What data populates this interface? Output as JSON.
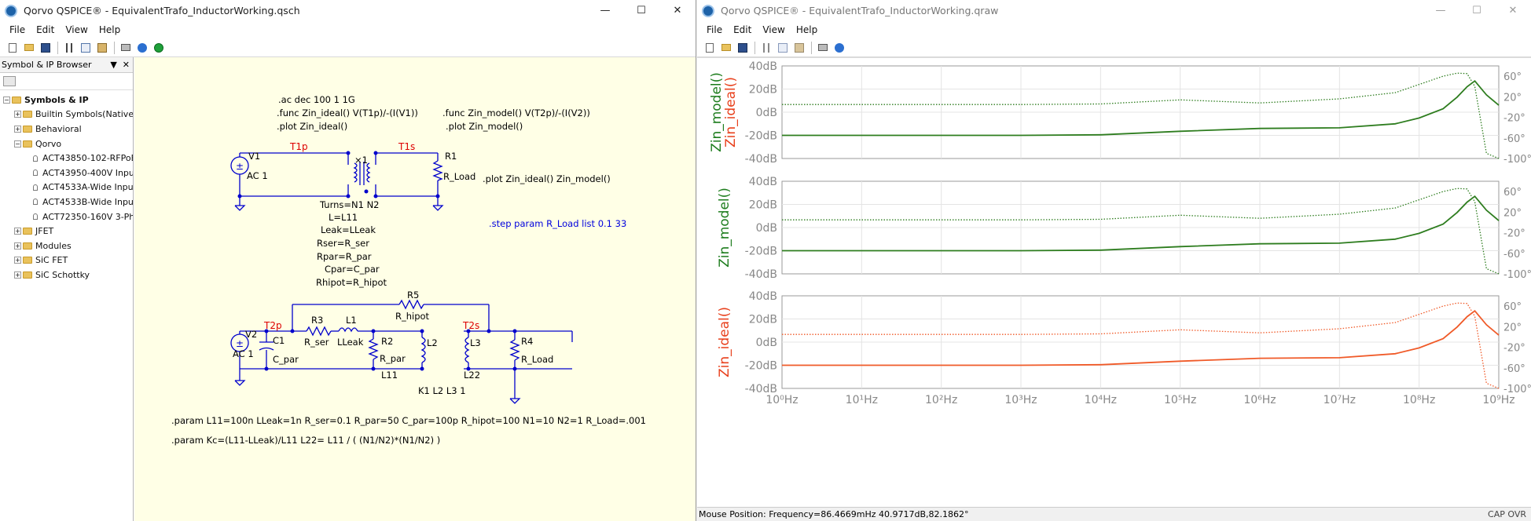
{
  "left_window": {
    "title": "Qorvo QSPICE® - EquivalentTrafo_InductorWorking.qsch",
    "menu": [
      "File",
      "Edit",
      "View",
      "Help"
    ],
    "toolbar_icons": [
      "new-file-icon",
      "open-folder-icon",
      "save-icon",
      "cut-icon",
      "copy-icon",
      "paste-icon",
      "print-icon",
      "help-icon",
      "run-icon"
    ]
  },
  "right_window": {
    "title": "Qorvo QSPICE® - EquivalentTrafo_InductorWorking.qraw",
    "menu": [
      "File",
      "Edit",
      "View",
      "Help"
    ],
    "toolbar_icons": [
      "new-file-icon",
      "open-folder-icon",
      "save-icon",
      "cut-icon",
      "copy-icon",
      "paste-icon",
      "print-icon",
      "help-icon"
    ],
    "status_text": "Mouse Position: Frequency=86.4669mHz   40.9717dB,82.1862°",
    "status_right": "CAP OVR"
  },
  "browser": {
    "title": "Symbol & IP Browser",
    "tree": [
      {
        "label": "Symbols & IP",
        "level": 0,
        "type": "folder",
        "expanded": true,
        "bold": true
      },
      {
        "label": "Builtin Symbols(Native D",
        "level": 1,
        "type": "folder",
        "expanded": false
      },
      {
        "label": "Behavioral",
        "level": 1,
        "type": "folder",
        "expanded": false
      },
      {
        "label": "Qorvo",
        "level": 1,
        "type": "folder",
        "expanded": true
      },
      {
        "label": "ACT43850-102-RFPoE",
        "level": 2,
        "type": "symbol"
      },
      {
        "label": "ACT43950-400V Input",
        "level": 2,
        "type": "symbol"
      },
      {
        "label": "ACT4533A-Wide Input",
        "level": 2,
        "type": "symbol"
      },
      {
        "label": "ACT4533B-Wide Input",
        "level": 2,
        "type": "symbol"
      },
      {
        "label": "ACT72350-160V 3-Ph",
        "level": 2,
        "type": "symbol"
      },
      {
        "label": "JFET",
        "level": 1,
        "type": "folder",
        "expanded": false
      },
      {
        "label": "Modules",
        "level": 1,
        "type": "folder",
        "expanded": false
      },
      {
        "label": "SiC FET",
        "level": 1,
        "type": "folder",
        "expanded": false
      },
      {
        "label": "SiC Schottky",
        "level": 1,
        "type": "folder",
        "expanded": false
      }
    ]
  },
  "schematic": {
    "directives_left": [
      ".ac dec 100 1 1G",
      ".func Zin_ideal() V(T1p)/-(I(V1))",
      ".plot Zin_ideal()"
    ],
    "directives_right": [
      ".func Zin_model() V(T2p)/-(I(V2))",
      ".plot Zin_model()"
    ],
    "plot_both": ".plot Zin_ideal() Zin_model()",
    "step": ".step param R_Load list 0.1 33",
    "params1": ".param L11=100n LLeak=1n R_ser=0.1 R_par=50 C_par=100p R_hipot=100 N1=10 N2=1 R_Load=.001",
    "params2": ".param Kc=(L11-LLeak)/L11 L22= L11 / ( (N1/N2)*(N1/N2) )",
    "trafo_attrs": [
      "Turns=N1 N2",
      "L=L11",
      "Leak=LLeak",
      "Rser=R_ser",
      "Rpar=R_par",
      "Cpar=C_par",
      "Rhipot=R_hipot"
    ],
    "trafo_ref": "×1",
    "nets": {
      "t1p": "T1p",
      "t1s": "T1s",
      "t2p": "T2p",
      "t2s": "T2s"
    },
    "v1": {
      "ref": "V1",
      "val": "AC 1"
    },
    "v2": {
      "ref": "V2",
      "val": "AC 1"
    },
    "r1": {
      "ref": "R1",
      "val": "R_Load"
    },
    "r2": {
      "ref": "R2",
      "val": "R_par"
    },
    "r3": {
      "ref": "R3",
      "val": "R_ser"
    },
    "r4": {
      "ref": "R4",
      "val": "R_Load"
    },
    "r5": {
      "ref": "R5",
      "val": "R_hipot"
    },
    "c1": {
      "ref": "C1",
      "val": "C_par"
    },
    "l1": {
      "ref": "L1",
      "val": "LLeak"
    },
    "l2": {
      "ref": "L2",
      "val": "L11"
    },
    "l3": {
      "ref": "L3",
      "val": "L22"
    },
    "k": "K1 L2 L3 1"
  },
  "plots": {
    "y_ticks_left": [
      "40dB",
      "20dB",
      "0dB",
      "-20dB",
      "-40dB"
    ],
    "y_ticks_right": [
      "60°",
      "20°",
      "-20°",
      "-60°",
      "-100°"
    ],
    "x_ticks": [
      "10⁰Hz",
      "10¹Hz",
      "10²Hz",
      "10³Hz",
      "10⁴Hz",
      "10⁵Hz",
      "10⁶Hz",
      "10⁷Hz",
      "10⁸Hz",
      "10⁹Hz"
    ],
    "panes": [
      {
        "labels": [
          "Zin_model()",
          "Zin_ideal()"
        ],
        "label_colors": [
          "#1e7d1e",
          "#e8401c"
        ],
        "color": "#2e7d1f"
      },
      {
        "labels": [
          "Zin_model()"
        ],
        "label_colors": [
          "#1e7d1e"
        ],
        "color": "#2e7d1f"
      },
      {
        "labels": [
          "Zin_ideal()"
        ],
        "label_colors": [
          "#e8401c"
        ],
        "color": "#f05a28"
      }
    ],
    "colors": {
      "green": "#2e7d1f",
      "orange": "#f05a28"
    }
  },
  "chart_data": {
    "type": "line",
    "xlabel": "",
    "ylabel": "",
    "x_scale": "log",
    "xlim": [
      1,
      1000000000
    ],
    "ylim": [
      -40,
      40
    ],
    "y2lim": [
      -100,
      80
    ],
    "x": [
      1,
      10,
      100,
      1000,
      10000,
      100000,
      1000000,
      10000000,
      50000000,
      100000000,
      200000000,
      300000000,
      400000000,
      500000000,
      700000000,
      1000000000
    ],
    "series": [
      {
        "name": "Zin_model()",
        "unit": "dB",
        "values": [
          -20,
          -20,
          -20,
          -20,
          -19.5,
          -16.5,
          -14,
          -13.5,
          -10,
          -5,
          3,
          13,
          22,
          27,
          15,
          6
        ]
      },
      {
        "name": "Zin_model()",
        "unit": "°",
        "values": [
          5,
          5,
          5,
          5,
          6,
          14,
          8,
          16,
          28,
          44,
          60,
          66,
          65,
          40,
          -90,
          -100
        ]
      }
    ]
  }
}
